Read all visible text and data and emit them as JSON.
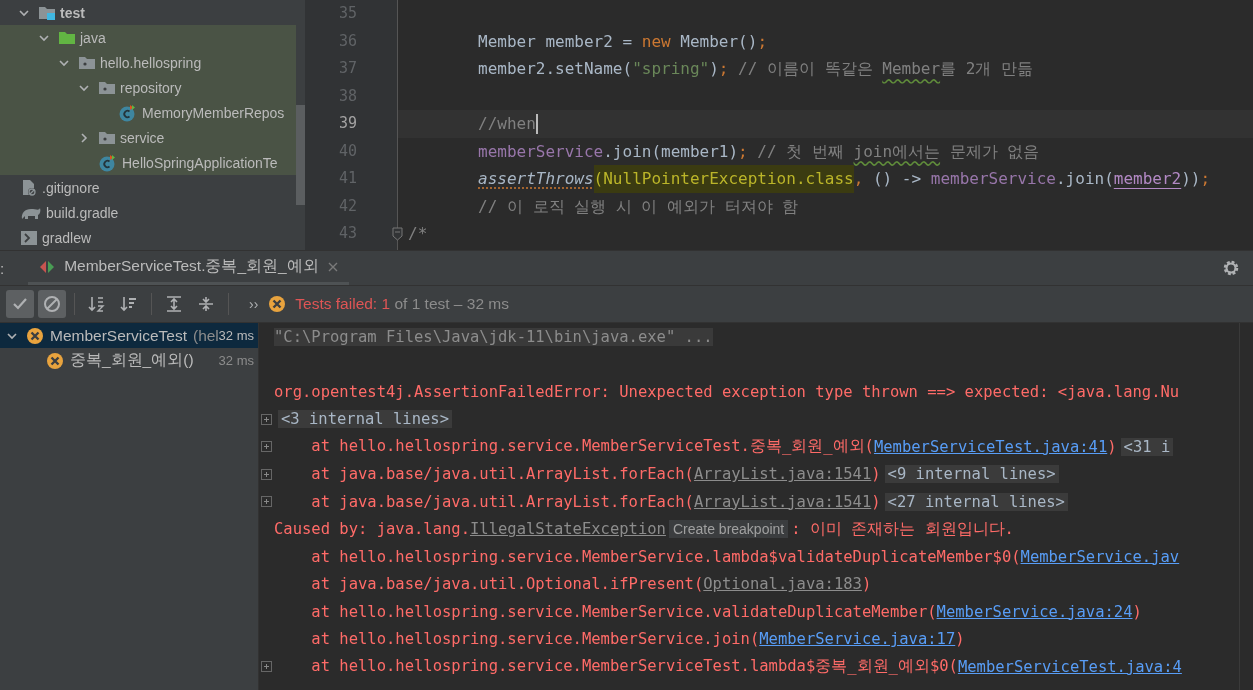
{
  "project_tree": {
    "items": [
      {
        "label": "test",
        "kind": "test-root",
        "highlighted": false,
        "expanded": true,
        "children": [
          {
            "label": "java",
            "kind": "source-folder",
            "highlighted": true,
            "expanded": true,
            "children": [
              {
                "label": "hello.hellospring",
                "kind": "package",
                "highlighted": true,
                "expanded": true,
                "children": [
                  {
                    "label": "repository",
                    "kind": "package",
                    "highlighted": true,
                    "expanded": true,
                    "children": [
                      {
                        "label": "MemoryMemberRepos",
                        "kind": "test-class",
                        "highlighted": true
                      }
                    ]
                  },
                  {
                    "label": "service",
                    "kind": "package",
                    "highlighted": true,
                    "expanded": false
                  },
                  {
                    "label": "HelloSpringApplicationTe",
                    "kind": "test-class",
                    "highlighted": true
                  }
                ]
              }
            ]
          }
        ]
      },
      {
        "label": ".gitignore",
        "kind": "ignore-file",
        "highlighted": false
      },
      {
        "label": "build.gradle",
        "kind": "gradle-file",
        "highlighted": false
      },
      {
        "label": "gradlew",
        "kind": "script-file",
        "highlighted": false
      }
    ]
  },
  "editor": {
    "lines": [
      {
        "number": "35",
        "current": false,
        "folded": false
      },
      {
        "number": "36",
        "current": false,
        "folded": false,
        "tokens": [
          {
            "text": "Member member2 = ",
            "kind": "plain"
          },
          {
            "text": "new",
            "kind": "keyword"
          },
          {
            "text": " Member()",
            "kind": "plain"
          },
          {
            "text": ";",
            "kind": "keyword"
          }
        ]
      },
      {
        "number": "37",
        "current": false,
        "folded": false,
        "tokens": [
          {
            "text": "member2.setName(",
            "kind": "plain"
          },
          {
            "text": "\"spring\"",
            "kind": "string"
          },
          {
            "text": ")",
            "kind": "plain"
          },
          {
            "text": ";",
            "kind": "keyword"
          },
          {
            "text": " // 이름이 똑같은 ",
            "kind": "comment"
          },
          {
            "text": "Member",
            "kind": "comment-typo"
          },
          {
            "text": "를 2개 만듦",
            "kind": "comment"
          }
        ]
      },
      {
        "number": "38",
        "current": false,
        "folded": false
      },
      {
        "number": "39",
        "current": true,
        "folded": false,
        "tokens": [
          {
            "text": "//when",
            "kind": "comment"
          }
        ]
      },
      {
        "number": "40",
        "current": false,
        "folded": false,
        "tokens": [
          {
            "text": "memberService",
            "kind": "field"
          },
          {
            "text": ".join(member1)",
            "kind": "plain"
          },
          {
            "text": ";",
            "kind": "keyword"
          },
          {
            "text": " // 첫 번째 ",
            "kind": "comment"
          },
          {
            "text": "join에서는",
            "kind": "comment-typo"
          },
          {
            "text": " 문제가 없음",
            "kind": "comment"
          }
        ]
      },
      {
        "number": "41",
        "current": false,
        "folded": false,
        "tokens": [
          {
            "text": "assertThrows",
            "kind": "static-call"
          },
          {
            "text": "(NullPointerException.class",
            "kind": "highlighted"
          },
          {
            "text": ", ",
            "kind": "keyword"
          },
          {
            "text": "() -> ",
            "kind": "plain"
          },
          {
            "text": "memberService",
            "kind": "field"
          },
          {
            "text": ".join(",
            "kind": "plain"
          },
          {
            "text": "member2",
            "kind": "parameter"
          },
          {
            "text": "))",
            "kind": "plain"
          },
          {
            "text": ";",
            "kind": "keyword"
          }
        ]
      },
      {
        "number": "42",
        "current": false,
        "folded": false,
        "tokens": [
          {
            "text": "// 이 로직 실행 시 이 예외가 터져야 함",
            "kind": "comment"
          }
        ]
      },
      {
        "number": "43",
        "current": false,
        "folded": true,
        "tokens": [
          {
            "text": "/*",
            "kind": "comment"
          }
        ]
      }
    ]
  },
  "run_panel": {
    "label": ":",
    "tabs": [
      {
        "title": "MemberServiceTest.중복_회원_예외",
        "selected": true
      }
    ],
    "toolbar": [
      {
        "kind": "show-passed",
        "on": true
      },
      {
        "kind": "show-ignored",
        "on": true
      },
      {
        "kind": "sort-alpha",
        "on": false
      },
      {
        "kind": "sort-duration",
        "on": false
      },
      {
        "kind": "expand-all",
        "on": false
      },
      {
        "kind": "collapse-all",
        "on": false
      }
    ],
    "more": "››",
    "status": {
      "failed": "Tests failed: 1",
      "rest": " of 1 test – 32 ms"
    },
    "test_tree": [
      {
        "label": "MemberServiceTest",
        "hint": "(hel",
        "time": "32 ms",
        "selected": true,
        "expanded": true,
        "children": [
          {
            "label": "중복_회원_예외()",
            "time": "32 ms",
            "selected": false
          }
        ]
      }
    ],
    "console": [
      {
        "foldable": false,
        "segments": [
          {
            "text": "\"C:\\Program Files\\Java\\jdk-11\\bin\\java.exe\" ...",
            "kind": "command"
          }
        ]
      },
      {
        "foldable": false
      },
      {
        "foldable": false,
        "segments": [
          {
            "text": "org.opentest4j.AssertionFailedError: Unexpected exception type thrown ==> expected: <java.lang.Nu",
            "kind": "error"
          }
        ]
      },
      {
        "foldable": true,
        "segments": [
          {
            "text": "<3 internal lines>",
            "kind": "folded"
          }
        ]
      },
      {
        "foldable": true,
        "segments": [
          {
            "text": "    at hello.hellospring.service.MemberServiceTest.중복_회원_예외(",
            "kind": "error"
          },
          {
            "text": "MemberServiceTest.java:41",
            "kind": "link"
          },
          {
            "text": ")",
            "kind": "error"
          },
          {
            "text": "<31 i",
            "kind": "folded"
          }
        ]
      },
      {
        "foldable": true,
        "segments": [
          {
            "text": "    at java.base/java.util.ArrayList.forEach(",
            "kind": "error"
          },
          {
            "text": "ArrayList.java:1541",
            "kind": "library-link"
          },
          {
            "text": ")",
            "kind": "error"
          },
          {
            "text": "<9 internal lines>",
            "kind": "folded"
          }
        ]
      },
      {
        "foldable": true,
        "segments": [
          {
            "text": "    at java.base/java.util.ArrayList.forEach(",
            "kind": "error"
          },
          {
            "text": "ArrayList.java:1541",
            "kind": "library-link"
          },
          {
            "text": ")",
            "kind": "error"
          },
          {
            "text": "<27 internal lines>",
            "kind": "folded"
          }
        ]
      },
      {
        "foldable": false,
        "segments": [
          {
            "text": "Caused by: java.lang.",
            "kind": "error"
          },
          {
            "text": "IllegalStateException",
            "kind": "library-link"
          },
          {
            "text": "Create breakpoint",
            "kind": "hint"
          },
          {
            "text": ": 이미 존재하는 회원입니다.",
            "kind": "error"
          }
        ]
      },
      {
        "foldable": false,
        "segments": [
          {
            "text": "    at hello.hellospring.service.MemberService.lambda$validateDuplicateMember$0(",
            "kind": "error"
          },
          {
            "text": "MemberService.jav",
            "kind": "link"
          }
        ]
      },
      {
        "foldable": false,
        "segments": [
          {
            "text": "    at java.base/java.util.Optional.ifPresent(",
            "kind": "error"
          },
          {
            "text": "Optional.java:183",
            "kind": "library-link"
          },
          {
            "text": ")",
            "kind": "error"
          }
        ]
      },
      {
        "foldable": false,
        "segments": [
          {
            "text": "    at hello.hellospring.service.MemberService.validateDuplicateMember(",
            "kind": "error"
          },
          {
            "text": "MemberService.java:24",
            "kind": "link"
          },
          {
            "text": ")",
            "kind": "error"
          }
        ]
      },
      {
        "foldable": false,
        "segments": [
          {
            "text": "    at hello.hellospring.service.MemberService.join(",
            "kind": "error"
          },
          {
            "text": "MemberService.java:17",
            "kind": "link"
          },
          {
            "text": ")",
            "kind": "error"
          }
        ]
      },
      {
        "foldable": true,
        "segments": [
          {
            "text": "    at hello.hellospring.service.MemberServiceTest.lambda$중복_회원_예외$0(",
            "kind": "error"
          },
          {
            "text": "MemberServiceTest.java:4",
            "kind": "link"
          }
        ]
      }
    ]
  }
}
